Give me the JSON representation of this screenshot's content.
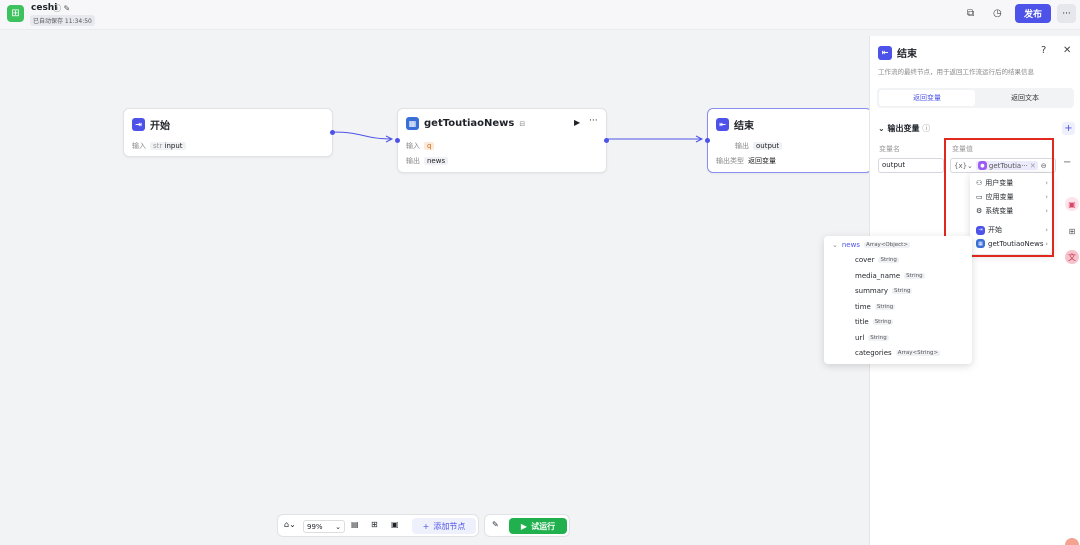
{
  "header": {
    "app_name": "ceshi",
    "autosave": "已自动保存 11:34:50",
    "publish_label": "发布",
    "more_label": "···"
  },
  "nodes": {
    "start": {
      "title": "开始",
      "input_label": "输入",
      "input_type": "str",
      "input_name": "input"
    },
    "plugin": {
      "title": "getToutiaoNews",
      "input_label": "输入",
      "input_name": "q",
      "output_label": "输出",
      "output_name": "news"
    },
    "end": {
      "title": "结束",
      "output_label": "输出",
      "output_name": "output",
      "output_type_label": "输出类型",
      "output_type_value": "返回变量"
    }
  },
  "panel": {
    "title": "结束",
    "description": "工作流的最终节点，用于返回工作流运行后的结果信息",
    "tabs": [
      "返回变量",
      "返回文本"
    ],
    "section_title": "输出变量",
    "col_name": "变量名",
    "col_value": "变量值",
    "var_name": "output",
    "var_value": "getToutia···"
  },
  "dropdown": {
    "items": [
      {
        "label": "用户变量"
      },
      {
        "label": "应用变量"
      },
      {
        "label": "系统变量"
      },
      {
        "label": "开始"
      },
      {
        "label": "getToutiaoNews"
      }
    ]
  },
  "subpanel": {
    "root": {
      "name": "news",
      "type": "Array<Object>"
    },
    "fields": [
      {
        "name": "cover",
        "type": "String"
      },
      {
        "name": "media_name",
        "type": "String"
      },
      {
        "name": "summary",
        "type": "String"
      },
      {
        "name": "time",
        "type": "String"
      },
      {
        "name": "title",
        "type": "String"
      },
      {
        "name": "url",
        "type": "String"
      },
      {
        "name": "categories",
        "type": "Array<String>"
      }
    ]
  },
  "toolbar": {
    "zoom": "99%",
    "add_node": "添加节点",
    "run": "试运行"
  },
  "colors": {
    "accent": "#4d53e8",
    "run": "#20b14e",
    "highlight": "#e0281e"
  }
}
